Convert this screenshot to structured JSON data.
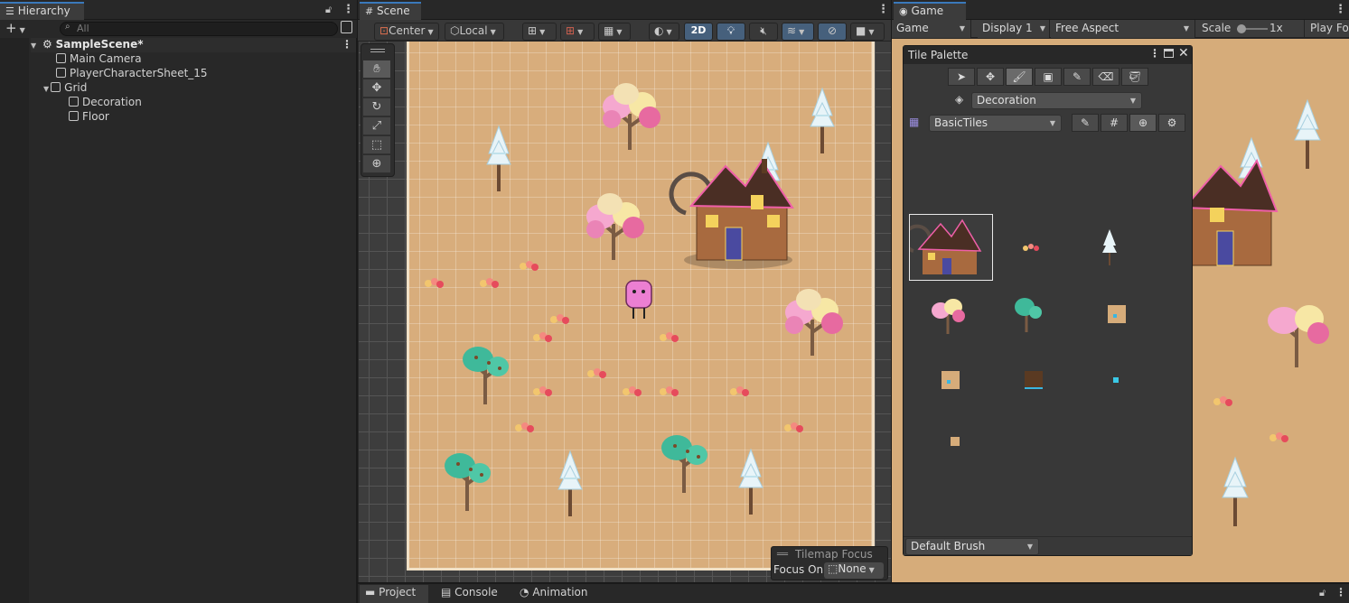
{
  "hierarchy": {
    "tab_label": "Hierarchy",
    "add_label": "+",
    "search_placeholder": "All",
    "scene_name": "SampleScene*",
    "items": [
      {
        "label": "Main Camera"
      },
      {
        "label": "PlayerCharacterSheet_15"
      },
      {
        "label": "Grid"
      },
      {
        "label": "Decoration"
      },
      {
        "label": "Floor"
      }
    ]
  },
  "scene": {
    "tab_label": "Scene",
    "pivot_label": "Center",
    "space_label": "Local",
    "mode_2d_label": "2D",
    "tilemap_focus": {
      "title": "Tilemap Focus",
      "focus_on_label": "Focus On",
      "focus_value": "None"
    }
  },
  "game": {
    "tab_label": "Game",
    "mode_label": "Game",
    "display_label": "Display 1",
    "aspect_label": "Free Aspect",
    "scale_label": "Scale",
    "scale_value": "1x",
    "play_focused_label": "Play Fo"
  },
  "tile_palette": {
    "title": "Tile Palette",
    "active_tilemap": "Decoration",
    "palette_name": "BasicTiles",
    "brush_name": "Default Brush"
  },
  "bottom": {
    "tabs": [
      {
        "label": "Project"
      },
      {
        "label": "Console"
      },
      {
        "label": "Animation"
      }
    ]
  },
  "colors": {
    "accent": "#3a79bb",
    "sand": "#d9b07f",
    "panel": "#282828"
  }
}
